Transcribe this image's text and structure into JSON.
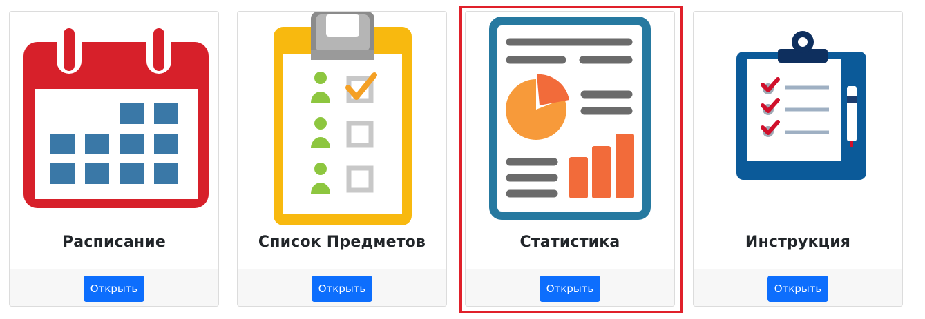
{
  "cards": [
    {
      "title": "Расписание",
      "button_label": "Открыть",
      "icon": "calendar-icon"
    },
    {
      "title": "Список Предметов",
      "button_label": "Открыть",
      "icon": "checklist-icon"
    },
    {
      "title": "Статистика",
      "button_label": "Открыть",
      "icon": "statistics-report-icon"
    },
    {
      "title": "Инструкция",
      "button_label": "Открыть",
      "icon": "clipboard-instructions-icon"
    }
  ],
  "colors": {
    "button": "#0d6efd",
    "highlight": "#e0202a",
    "calendar_red": "#d7202a",
    "calendar_cells": "#3a78a7",
    "checklist_orange": "#f8b90f",
    "checklist_person": "#8dc63f",
    "stats_frame": "#2679a0",
    "stats_orange": "#f26b3a",
    "clipboard_blue": "#0b5a99"
  }
}
